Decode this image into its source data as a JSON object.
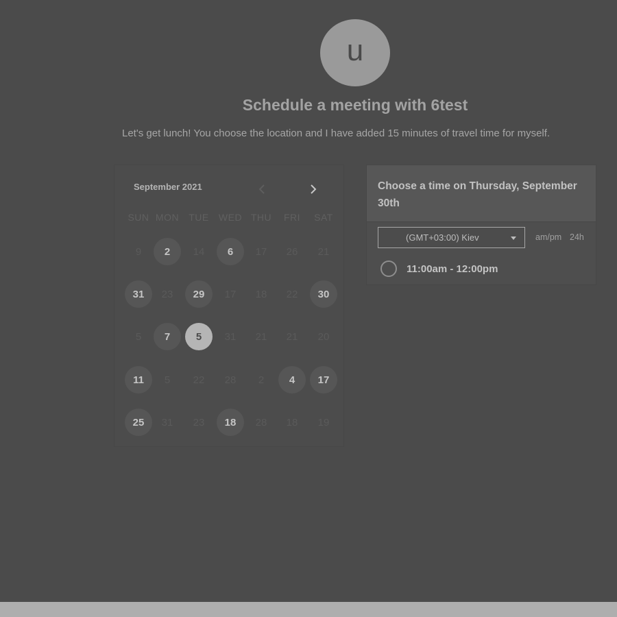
{
  "profile": {
    "avatar_letter": "u"
  },
  "header": {
    "title": "Schedule a meeting with 6test",
    "description": "Let's get lunch! You choose the location and I have added 15 minutes of travel time for myself."
  },
  "calendar": {
    "month_label": "September 2021",
    "prev_icon": "chevron-left-icon",
    "next_icon": "chevron-right-icon",
    "weekdays": [
      "SUN",
      "MON",
      "TUE",
      "WED",
      "THU",
      "FRI",
      "SAT"
    ],
    "weeks": [
      [
        {
          "d": "9",
          "s": "off"
        },
        {
          "d": "2",
          "s": "avail"
        },
        {
          "d": "14",
          "s": "off"
        },
        {
          "d": "6",
          "s": "avail"
        },
        {
          "d": "17",
          "s": "off"
        },
        {
          "d": "26",
          "s": "off"
        },
        {
          "d": "21",
          "s": "off"
        }
      ],
      [
        {
          "d": "31",
          "s": "avail"
        },
        {
          "d": "23",
          "s": "off"
        },
        {
          "d": "29",
          "s": "avail"
        },
        {
          "d": "17",
          "s": "off"
        },
        {
          "d": "18",
          "s": "off"
        },
        {
          "d": "22",
          "s": "off"
        },
        {
          "d": "30",
          "s": "avail"
        }
      ],
      [
        {
          "d": "5",
          "s": "off"
        },
        {
          "d": "7",
          "s": "avail"
        },
        {
          "d": "5",
          "s": "selected"
        },
        {
          "d": "31",
          "s": "off"
        },
        {
          "d": "21",
          "s": "off"
        },
        {
          "d": "21",
          "s": "off"
        },
        {
          "d": "20",
          "s": "off"
        }
      ],
      [
        {
          "d": "11",
          "s": "avail"
        },
        {
          "d": "5",
          "s": "off"
        },
        {
          "d": "22",
          "s": "off"
        },
        {
          "d": "28",
          "s": "off"
        },
        {
          "d": "2",
          "s": "off"
        },
        {
          "d": "4",
          "s": "avail"
        },
        {
          "d": "17",
          "s": "avail"
        }
      ],
      [
        {
          "d": "25",
          "s": "avail"
        },
        {
          "d": "31",
          "s": "off"
        },
        {
          "d": "23",
          "s": "off"
        },
        {
          "d": "18",
          "s": "avail"
        },
        {
          "d": "28",
          "s": "off"
        },
        {
          "d": "18",
          "s": "off"
        },
        {
          "d": "19",
          "s": "off"
        }
      ]
    ]
  },
  "time_panel": {
    "heading": "Choose a time on Thursday, September 30th",
    "timezone": "(GMT+03:00) Kiev",
    "format_ampm": "am/pm",
    "format_24h": "24h",
    "slots": [
      {
        "label": "11:00am - 12:00pm"
      }
    ]
  },
  "colors": {
    "background": "#4b4b4b",
    "available_day": "#565656",
    "selected_day": "#b5b5b5"
  }
}
